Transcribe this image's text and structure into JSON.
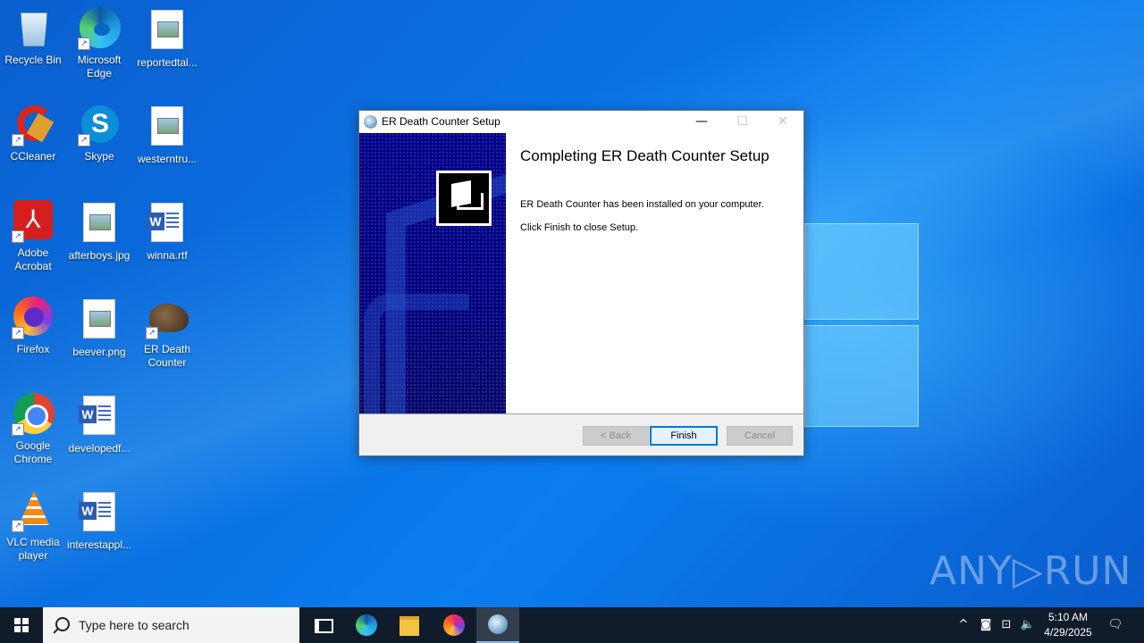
{
  "desktop": {
    "icons": [
      {
        "label": "Recycle Bin",
        "icon": "recycle-bin-icon"
      },
      {
        "label": "Microsoft Edge",
        "icon": "edge-icon"
      },
      {
        "label": "reportedtal...",
        "icon": "image-file-icon"
      },
      {
        "label": "CCleaner",
        "icon": "ccleaner-icon"
      },
      {
        "label": "Skype",
        "icon": "skype-icon"
      },
      {
        "label": "westerntru...",
        "icon": "image-file-icon"
      },
      {
        "label": "Adobe Acrobat",
        "icon": "acrobat-icon"
      },
      {
        "label": "afterboys.jpg",
        "icon": "image-file-icon"
      },
      {
        "label": "winna.rtf",
        "icon": "word-doc-icon"
      },
      {
        "label": "Firefox",
        "icon": "firefox-icon"
      },
      {
        "label": "beever.png",
        "icon": "image-file-icon"
      },
      {
        "label": "ER Death Counter",
        "icon": "er-death-counter-icon"
      },
      {
        "label": "Google Chrome",
        "icon": "chrome-icon"
      },
      {
        "label": "developedf...",
        "icon": "word-doc-icon"
      },
      {
        "label": "VLC media player",
        "icon": "vlc-icon"
      },
      {
        "label": "interestappl...",
        "icon": "word-doc-icon"
      }
    ]
  },
  "dialog": {
    "title": "ER Death Counter Setup",
    "heading": "Completing ER Death Counter Setup",
    "message1": "ER Death Counter has been installed on your computer.",
    "message2": "Click Finish to close Setup.",
    "buttons": {
      "back": "< Back",
      "finish": "Finish",
      "cancel": "Cancel"
    },
    "controls": {
      "minimize": "—",
      "maximize": "☐",
      "close": "✕"
    }
  },
  "taskbar": {
    "search_placeholder": "Type here to search",
    "time": "5:10 AM",
    "date": "4/29/2025"
  },
  "watermark": "ANY▷RUN",
  "colors": {
    "accent": "#0078d7",
    "installer_side": "#000080",
    "taskbar": "#101c2c"
  }
}
